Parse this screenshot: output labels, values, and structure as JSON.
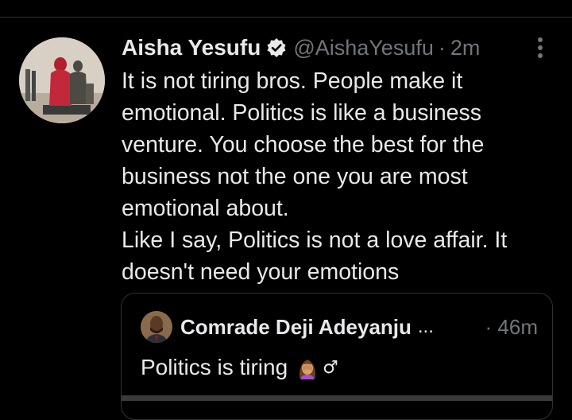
{
  "tweet": {
    "author_name": "Aisha Yesufu",
    "handle": "@AishaYesufu",
    "separator": "·",
    "timestamp": "2m",
    "lines": [
      "It is not tiring bros. People make it",
      "emotional. Politics is like a business",
      "venture. You choose the best for the",
      "business not the one you are most",
      "emotional about.",
      "Like I say, Politics is not a love affair. It",
      "doesn't need your emotions"
    ],
    "icons": {
      "verified": "verified-badge-icon",
      "more": "more-vertical-icon"
    }
  },
  "quote": {
    "author_name": "Comrade Deji Adeyanju",
    "ellipsis": "...",
    "time": "· 46m",
    "text": "Politics is tiring",
    "emoji": "face-palm-woman-emoji",
    "male_sign": "♂"
  },
  "colors": {
    "background": "#000000",
    "text": "#e7e9ea",
    "secondary": "#71767b",
    "border": "#2f3336"
  }
}
